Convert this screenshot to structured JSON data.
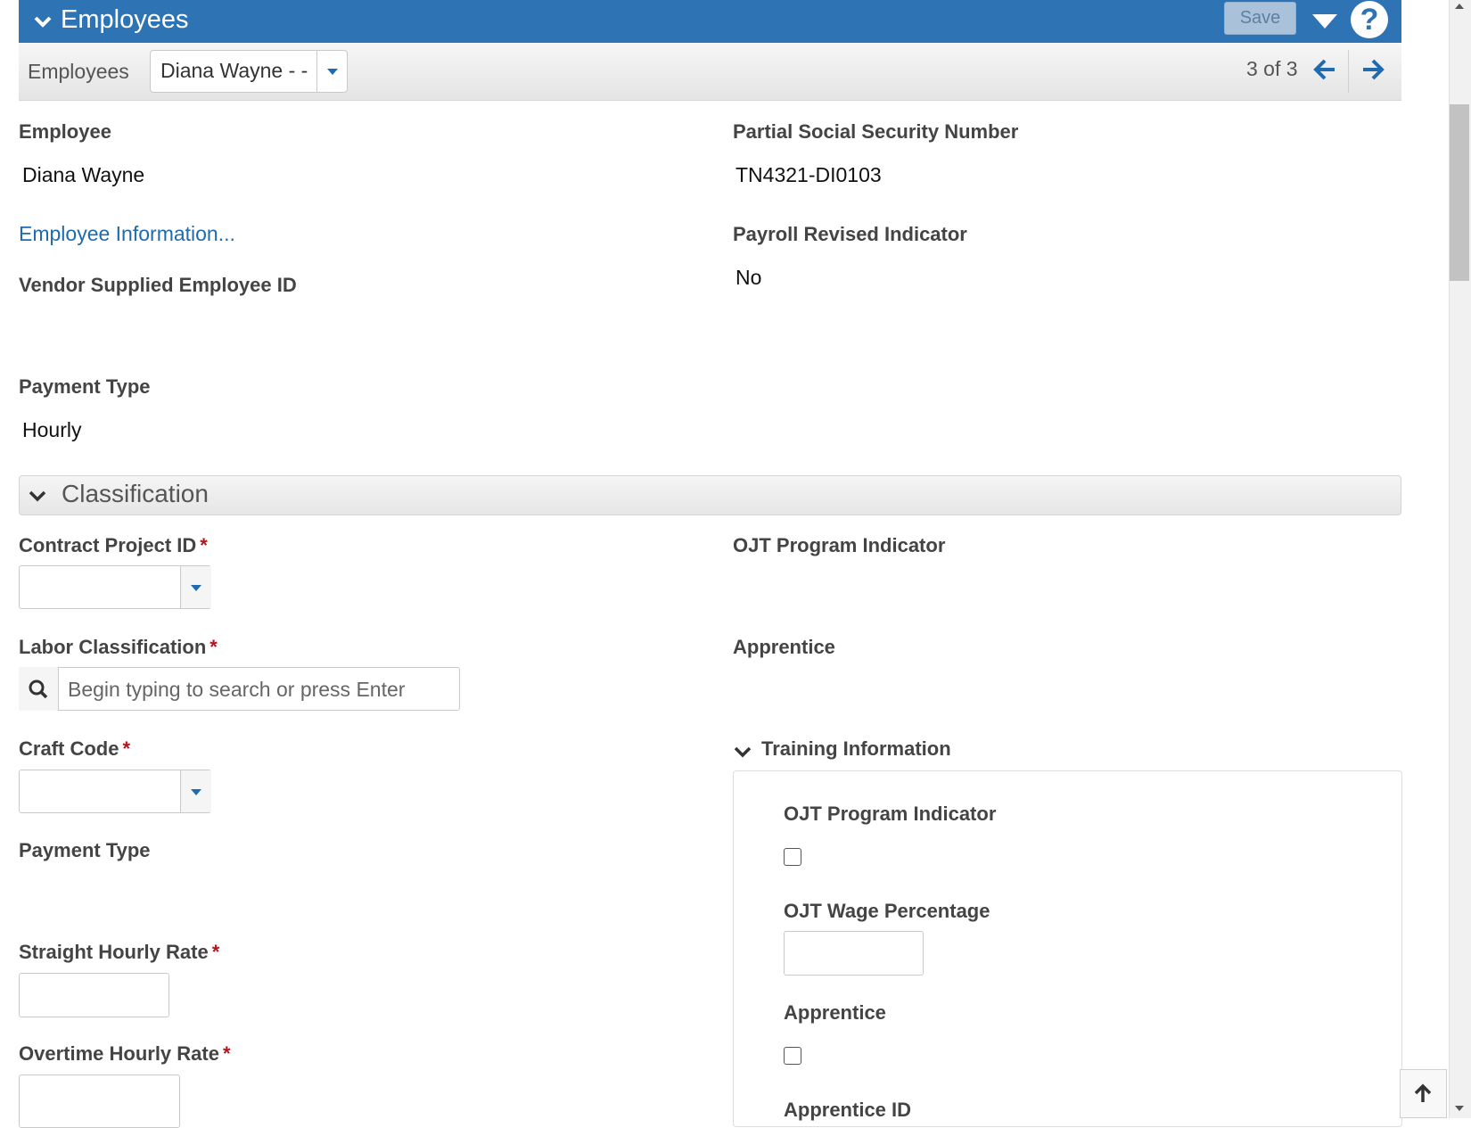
{
  "header": {
    "title": "Employees",
    "save_label": "Save",
    "help_glyph": "?",
    "icons": [
      "chevron-down-icon",
      "caret-down-icon",
      "help-icon"
    ]
  },
  "toolbar": {
    "label": "Employees",
    "selected_employee": "Diana Wayne - -",
    "pager": "3 of 3"
  },
  "employee_section": {
    "employee_label": "Employee",
    "employee_value": "Diana Wayne",
    "ssn_label": "Partial Social Security Number",
    "ssn_value": "TN4321-DI0103",
    "employee_info_link": "Employee Information...",
    "payroll_revised_label": "Payroll Revised Indicator",
    "payroll_revised_value": "No",
    "vendor_id_label": "Vendor Supplied Employee ID",
    "payment_type_label": "Payment Type",
    "payment_type_value": "Hourly"
  },
  "classification": {
    "title": "Classification",
    "contract_project_label": "Contract Project ID",
    "ojt_program_label": "OJT Program Indicator",
    "labor_class_label": "Labor Classification",
    "labor_class_placeholder": "Begin typing to search or press Enter",
    "apprentice_label": "Apprentice",
    "craft_code_label": "Craft Code",
    "payment_type_label": "Payment Type",
    "straight_rate_label": "Straight Hourly Rate",
    "overtime_rate_label": "Overtime Hourly Rate",
    "required_marker": "*"
  },
  "training": {
    "title": "Training Information",
    "ojt_indicator_label": "OJT Program Indicator",
    "ojt_indicator_checked": false,
    "ojt_wage_label": "OJT Wage Percentage",
    "apprentice_label": "Apprentice",
    "apprentice_checked": false,
    "apprentice_id_label": "Apprentice ID"
  },
  "colors": {
    "header_bg": "#2e74b5",
    "link": "#1e6bb0",
    "required": "#b3141c"
  }
}
